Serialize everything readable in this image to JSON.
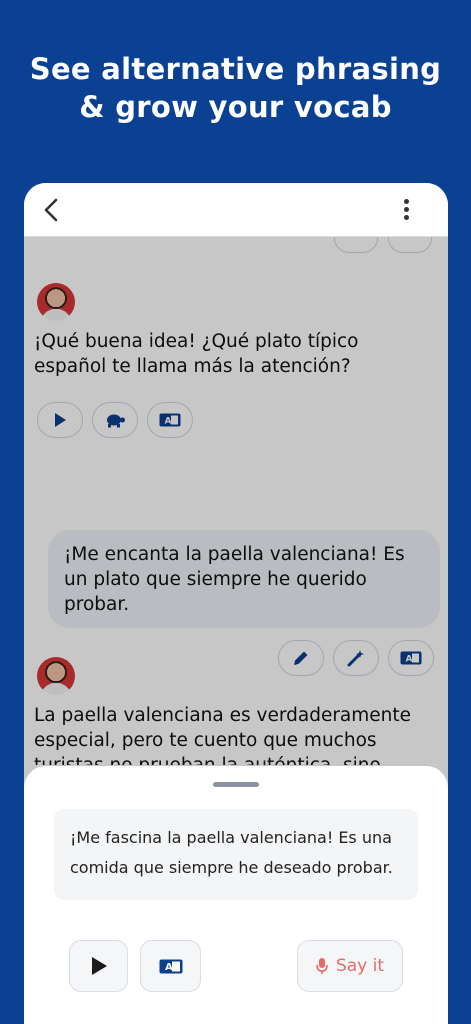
{
  "headline": {
    "line1": "See alternative phrasing",
    "line2": "& grow your vocab"
  },
  "chat": {
    "bot_message_1": "¡Qué buena idea! ¿Qué plato típico español te llama más la atención?",
    "user_message": "¡Me encanta la paella valenciana! Es un plato que siempre he querido probar.",
    "bot_message_2": "La paella valenciana es verdaderamente especial, pero te cuento que muchos turistas no prueban la auténtica, sino"
  },
  "sheet": {
    "alternative_phrasing": "¡Me fascina la paella valenciana! Es una comida que siempre he deseado probar.",
    "say_it_label": "Say it"
  },
  "colors": {
    "background": "#0b4193",
    "accent_red": "#e86a6a",
    "icon_blue": "#0d3f8f"
  },
  "icons": [
    "chevron-left-icon",
    "more-vertical-icon",
    "play-icon",
    "turtle-icon",
    "translate-icon",
    "pencil-icon",
    "magic-wand-icon",
    "microphone-icon"
  ]
}
